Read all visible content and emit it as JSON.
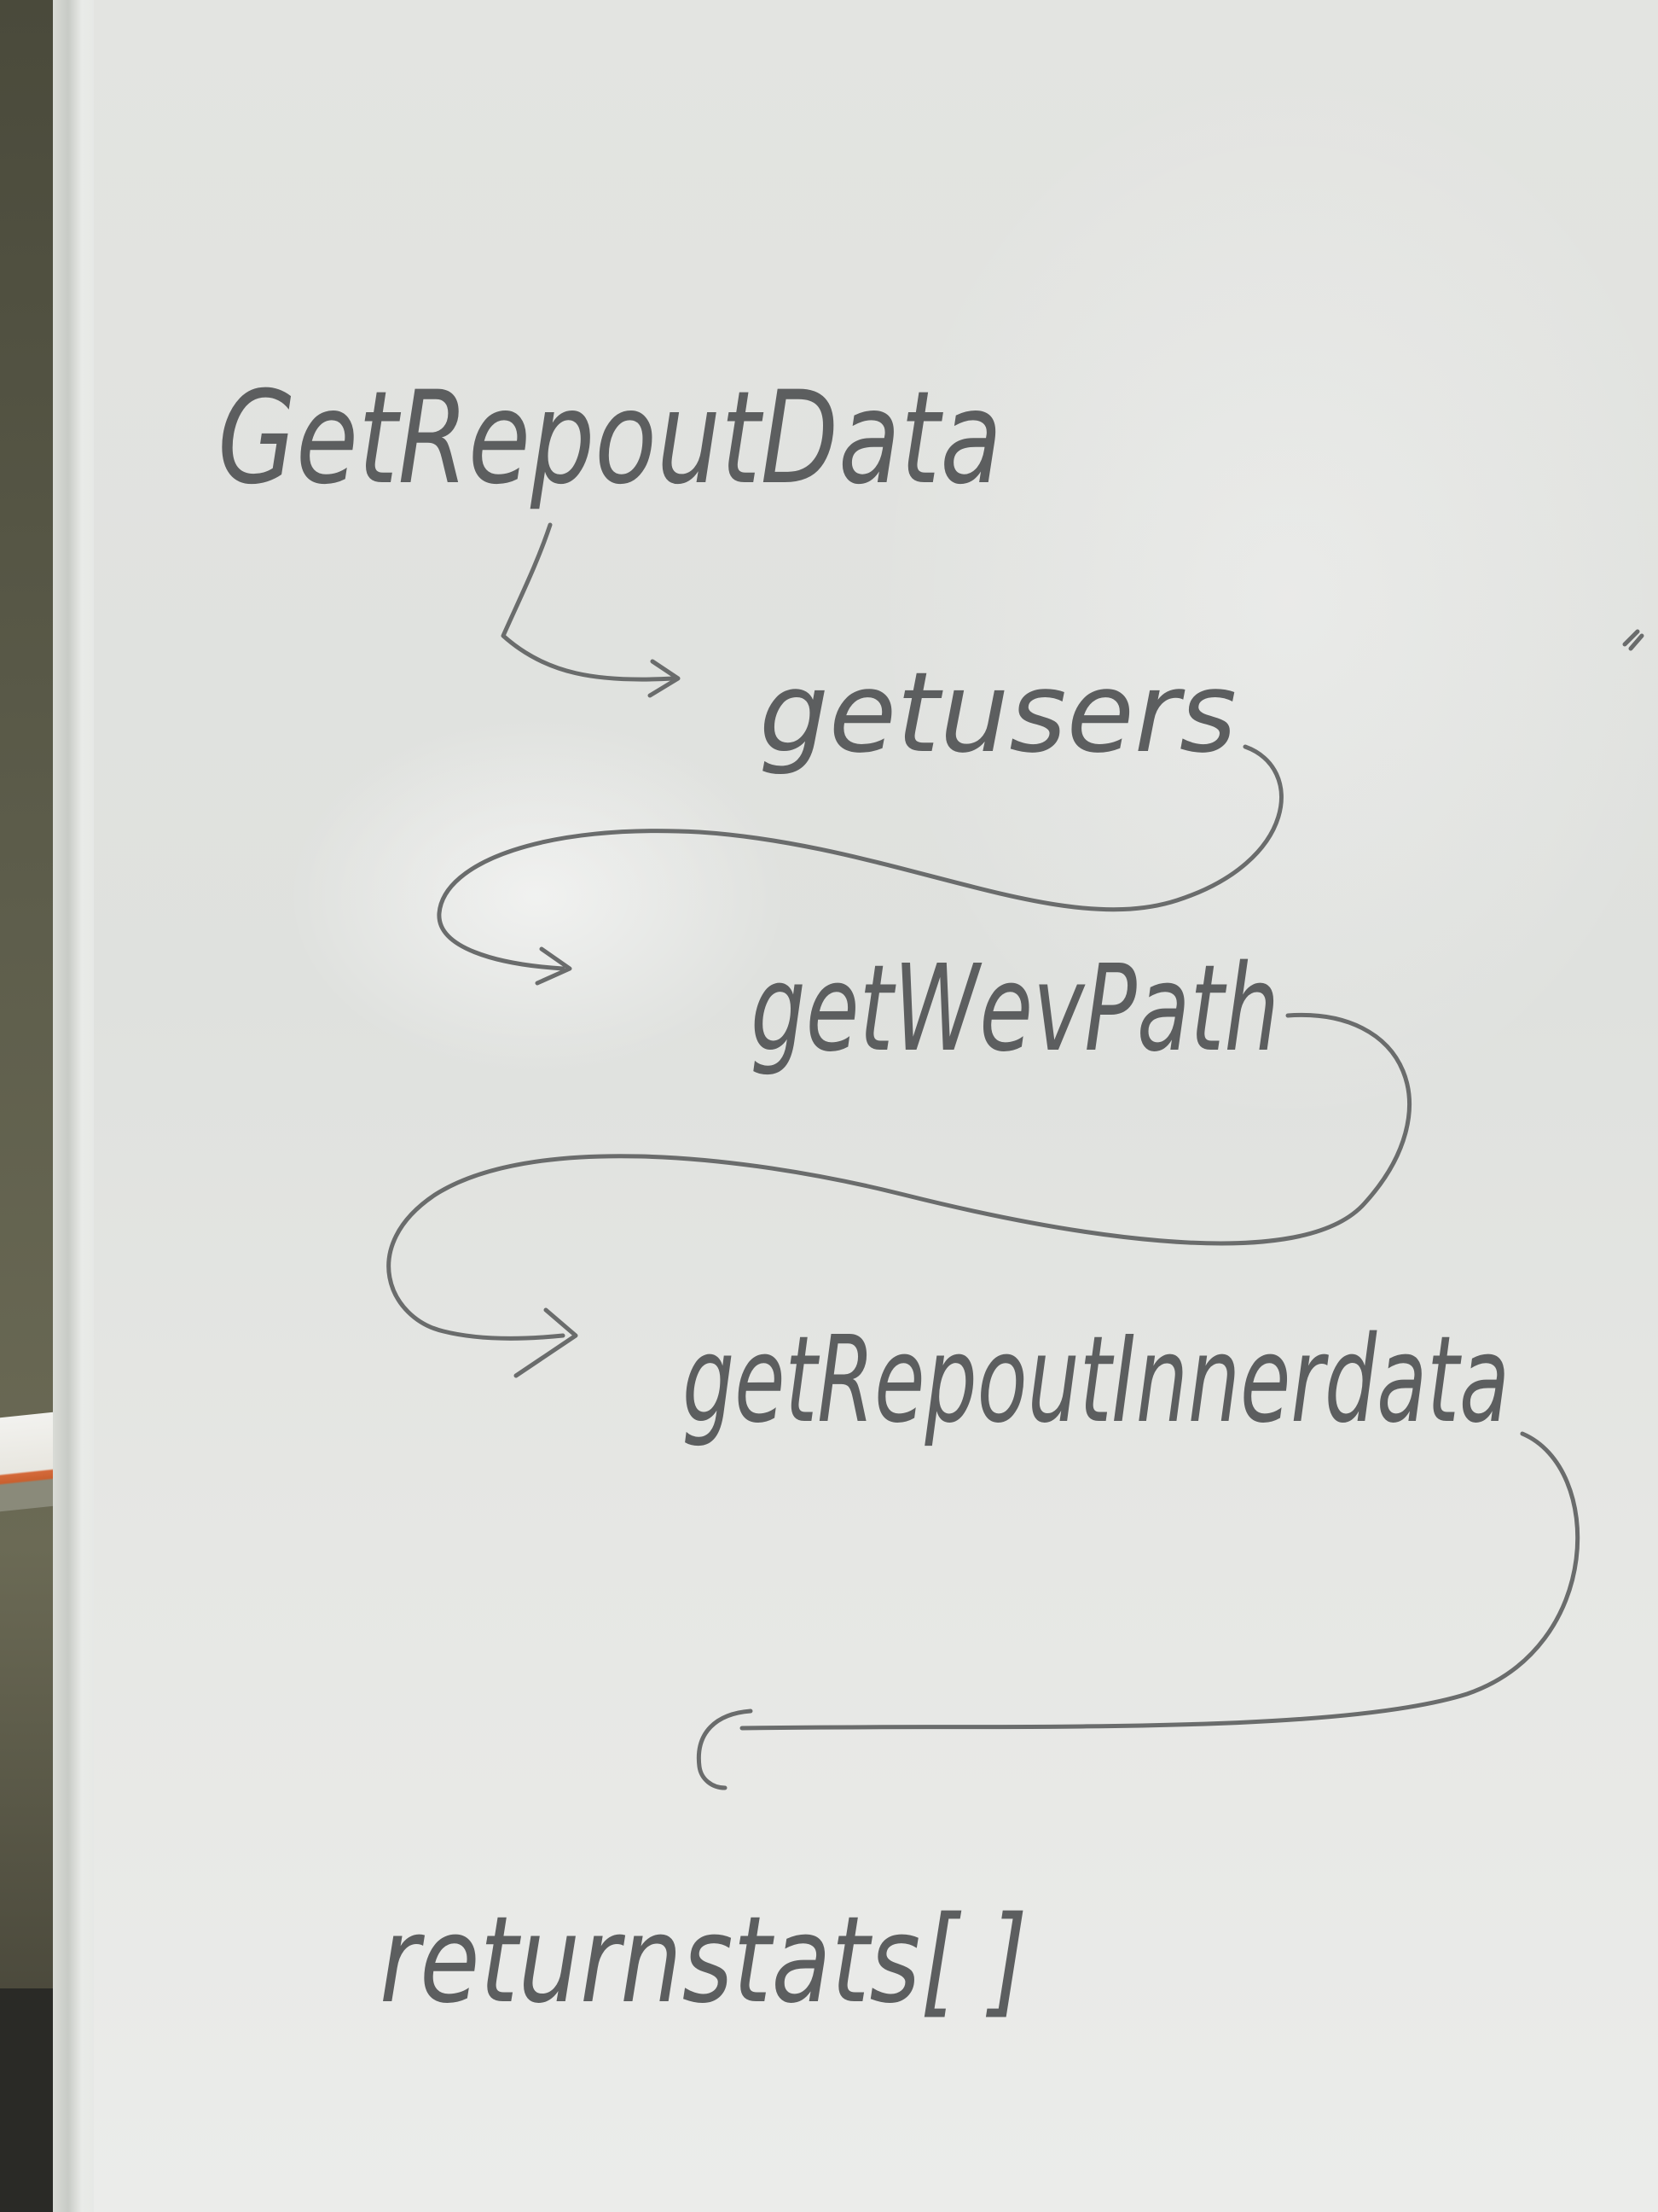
{
  "whiteboard": {
    "steps": [
      {
        "label": "GetRepoutData"
      },
      {
        "label": "getusers"
      },
      {
        "label": "getWevPath"
      },
      {
        "label": "getRepoutInnerdata"
      },
      {
        "label": "returnstats[ ]"
      }
    ]
  },
  "colors": {
    "ink": "#5c5e5f",
    "board": "#e3e4e1"
  }
}
